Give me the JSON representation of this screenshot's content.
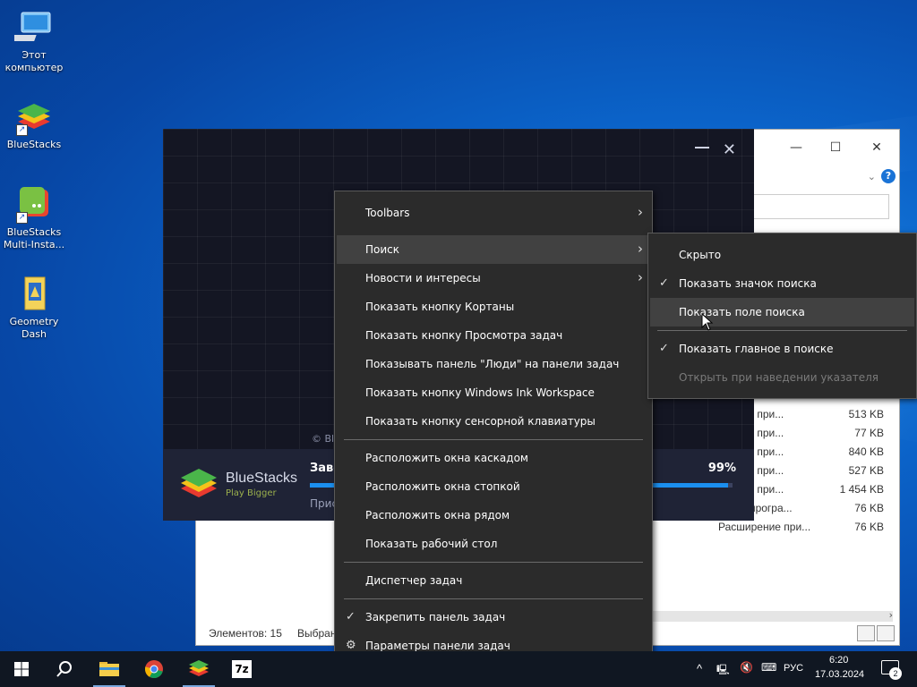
{
  "desktop": {
    "icons": [
      {
        "label": "Этот компьютер"
      },
      {
        "label": "BlueStacks"
      },
      {
        "label": "BlueStacks Multi-Insta..."
      },
      {
        "label": "Geometry Dash"
      }
    ]
  },
  "explorer": {
    "rows": [
      {
        "type": "ирение при...",
        "size": "513 KB"
      },
      {
        "type": "ирение при...",
        "size": "77 KB"
      },
      {
        "type": "ирение при...",
        "size": "840 KB"
      },
      {
        "type": "ирение при...",
        "size": "527 KB"
      },
      {
        "type": "ирение при...",
        "size": "1 454 KB"
      },
      {
        "type": "новке програ...",
        "size": "76 KB"
      },
      {
        "type": "Расширение при...",
        "size": "76 KB"
      }
    ],
    "status_items": "Элементов: 15",
    "status_selected": "Выбран"
  },
  "bluestacks": {
    "logo_text": "BlueStacks",
    "logo_sub": "Play Bigger",
    "status_title": "Заве",
    "status_sub": "Прис",
    "progress_label": "99%",
    "progress_value": 0.99,
    "copyright": "© Bl"
  },
  "context_menu": {
    "items": [
      {
        "label": "Toolbars",
        "submenu": true
      },
      {
        "label": "Поиск",
        "submenu": true,
        "highlighted": true
      },
      {
        "label": "Новости и интересы",
        "submenu": true
      },
      {
        "label": "Показать кнопку Кортаны"
      },
      {
        "label": "Показать кнопку Просмотра задач"
      },
      {
        "label": "Показывать панель \"Люди\" на панели задач"
      },
      {
        "label": "Показать кнопку Windows Ink Workspace"
      },
      {
        "label": "Показать кнопку сенсорной клавиатуры"
      },
      {
        "label": "Расположить окна каскадом"
      },
      {
        "label": "Расположить окна стопкой"
      },
      {
        "label": "Расположить окна рядом"
      },
      {
        "label": "Показать рабочий стол"
      },
      {
        "label": "Диспетчер задач"
      },
      {
        "label": "Закрепить панель задач",
        "checked": true
      },
      {
        "label": "Параметры панели задач",
        "icon": "gear-icon"
      }
    ]
  },
  "search_submenu": {
    "items": [
      {
        "label": "Скрыто"
      },
      {
        "label": "Показать значок поиска",
        "checked": true
      },
      {
        "label": "Показать поле поиска",
        "highlighted": true
      },
      {
        "label": "Показать главное в поиске",
        "checked": true
      },
      {
        "label": "Открыть при наведении указателя",
        "disabled": true
      }
    ]
  },
  "taskbar": {
    "apps": [
      "start-icon",
      "search-icon",
      "file-explorer-icon",
      "chrome-icon",
      "bluestacks-icon",
      "7zip-icon"
    ],
    "language": "РУС",
    "time": "6:20",
    "date": "17.03.2024",
    "notification_count": "2"
  },
  "colors": {
    "menu_bg": "#2b2b2b",
    "menu_highlight": "#414141",
    "taskbar_bg": "#101722",
    "progress_fill": "#1b8fef"
  }
}
